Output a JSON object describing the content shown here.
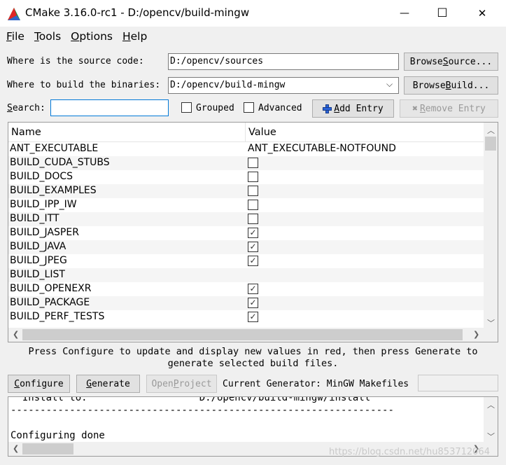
{
  "window": {
    "title": "CMake 3.16.0-rc1 - D:/opencv/build-mingw",
    "min_glyph": "—",
    "max_glyph": "☐",
    "close_glyph": "✕"
  },
  "menu": [
    {
      "u": "F",
      "rest": "ile"
    },
    {
      "u": "T",
      "rest": "ools"
    },
    {
      "u": "O",
      "rest": "ptions"
    },
    {
      "u": "H",
      "rest": "elp"
    }
  ],
  "source": {
    "label": "Where is the source code:",
    "value": "D:/opencv/sources",
    "browse_button": {
      "pre": "Browse ",
      "u": "S",
      "post": "ource..."
    }
  },
  "build": {
    "label": "Where to build the binaries:",
    "value": "D:/opencv/build-mingw",
    "browse_button": {
      "pre": "Browse ",
      "u": "B",
      "post": "uild..."
    }
  },
  "search": {
    "label_u": "S",
    "label_rest": "earch:",
    "value": ""
  },
  "options": {
    "grouped": "Grouped",
    "advanced": "Advanced",
    "add_entry": {
      "u": "A",
      "rest": "dd Entry"
    },
    "remove_entry": {
      "u": "R",
      "rest": "emove Entry"
    }
  },
  "table": {
    "col_name": "Name",
    "col_value": "Value",
    "rows": [
      {
        "name": "ANT_EXECUTABLE",
        "type": "text",
        "value": "ANT_EXECUTABLE-NOTFOUND"
      },
      {
        "name": "BUILD_CUDA_STUBS",
        "type": "bool",
        "checked": false
      },
      {
        "name": "BUILD_DOCS",
        "type": "bool",
        "checked": false
      },
      {
        "name": "BUILD_EXAMPLES",
        "type": "bool",
        "checked": false
      },
      {
        "name": "BUILD_IPP_IW",
        "type": "bool",
        "checked": false
      },
      {
        "name": "BUILD_ITT",
        "type": "bool",
        "checked": false
      },
      {
        "name": "BUILD_JASPER",
        "type": "bool",
        "checked": true
      },
      {
        "name": "BUILD_JAVA",
        "type": "bool",
        "checked": true
      },
      {
        "name": "BUILD_JPEG",
        "type": "bool",
        "checked": true
      },
      {
        "name": "BUILD_LIST",
        "type": "text",
        "value": ""
      },
      {
        "name": "BUILD_OPENEXR",
        "type": "bool",
        "checked": true
      },
      {
        "name": "BUILD_PACKAGE",
        "type": "bool",
        "checked": true
      },
      {
        "name": "BUILD_PERF_TESTS",
        "type": "bool",
        "checked": true
      }
    ]
  },
  "hint": {
    "line1": "Press Configure to update and display new values in red, then press Generate to",
    "line2": "generate selected build files."
  },
  "actions": {
    "configure": {
      "u": "C",
      "rest": "onfigure"
    },
    "generate": {
      "u": "G",
      "rest": "enerate"
    },
    "open_project": {
      "pre": "Open ",
      "u": "P",
      "post": "roject"
    },
    "generator_label": "Current Generator: MinGW Makefiles"
  },
  "output": {
    "lines": [
      "  Install to:                   D:/opencv/build-mingw/install",
      "-----------------------------------------------------------------",
      "",
      "Configuring done"
    ]
  },
  "watermark": "https://blog.csdn.net/hu853712064"
}
